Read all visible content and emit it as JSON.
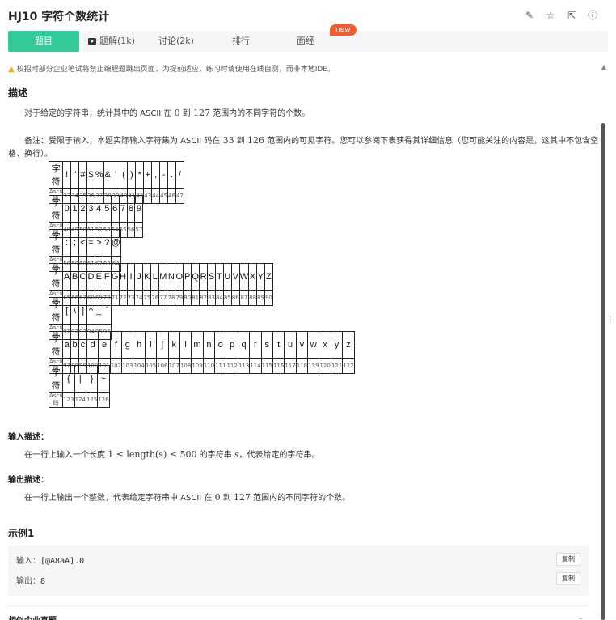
{
  "header": {
    "title": "HJ10  字符个数统计",
    "icons": [
      "edit-icon",
      "star-icon",
      "share-icon",
      "info-icon"
    ]
  },
  "tabs": [
    {
      "label": "题目",
      "active": true
    },
    {
      "label": "题解(1k)",
      "icon": "video-icon"
    },
    {
      "label": "讨论(2k)"
    },
    {
      "label": "排行"
    },
    {
      "label": "面经"
    }
  ],
  "new_badge": "new",
  "warning": "校招时部分企业笔试将禁止编程题跳出页面，为提前适应，练习时请使用在线自测，而非本地IDE。",
  "description": {
    "title": "描述",
    "p1_a": "对于给定的字符串，统计其中的 ASCII 在 ",
    "p1_n1": "0",
    "p1_b": " 到 ",
    "p1_n2": "127",
    "p1_c": " 范围内的不同字符的个数。",
    "note_a": "备注：受限于输入，本题实际输入字符集为 ASCII 码在 ",
    "note_n1": "33",
    "note_b": " 到 ",
    "note_n2": "126",
    "note_c": " 范围内的可见字符。您可以参阅下表获得其详细信息（您可能关注的内容是，这其中不包含空格、换行）。"
  },
  "ascii_table": {
    "char_label": "字符",
    "code_label": "Ascii码",
    "rows": [
      {
        "chars": [
          "!",
          "\"",
          "#",
          "$",
          "%",
          "&",
          "'",
          "(",
          ")",
          "*",
          "+",
          ",",
          "-",
          ".",
          "/"
        ],
        "codes": [
          "33",
          "34",
          "35",
          "36",
          "37",
          "38",
          "39",
          "40",
          "41",
          "42",
          "43",
          "44",
          "45",
          "46",
          "47"
        ]
      },
      {
        "chars": [
          "0",
          "1",
          "2",
          "3",
          "4",
          "5",
          "6",
          "7",
          "8",
          "9"
        ],
        "codes": [
          "48",
          "49",
          "50",
          "51",
          "52",
          "53",
          "54",
          "55",
          "56",
          "57"
        ]
      },
      {
        "chars": [
          ":",
          ";",
          "<",
          "=",
          ">",
          "?",
          "@"
        ],
        "codes": [
          "58",
          "59",
          "60",
          "61",
          "62",
          "63",
          "64"
        ]
      },
      {
        "chars": [
          "A",
          "B",
          "C",
          "D",
          "E",
          "F",
          "G",
          "H",
          "I",
          "J",
          "K",
          "L",
          "M",
          "N",
          "O",
          "P",
          "Q",
          "R",
          "S",
          "T",
          "U",
          "V",
          "W",
          "X",
          "Y",
          "Z"
        ],
        "codes": [
          "65",
          "66",
          "67",
          "68",
          "69",
          "70",
          "71",
          "72",
          "73",
          "74",
          "75",
          "76",
          "77",
          "78",
          "79",
          "80",
          "81",
          "82",
          "83",
          "84",
          "85",
          "86",
          "87",
          "88",
          "89",
          "90"
        ]
      },
      {
        "chars": [
          "[",
          "\\",
          "]",
          "^",
          "_",
          "`"
        ],
        "codes": [
          "91",
          "92",
          "93",
          "94",
          "95",
          "96"
        ]
      },
      {
        "chars": [
          "a",
          "b",
          "c",
          "d",
          "e",
          "f",
          "g",
          "h",
          "i",
          "j",
          "k",
          "l",
          "m",
          "n",
          "o",
          "p",
          "q",
          "r",
          "s",
          "t",
          "u",
          "v",
          "w",
          "x",
          "y",
          "z"
        ],
        "codes": [
          "97",
          "98",
          "99",
          "100",
          "101",
          "102",
          "103",
          "104",
          "105",
          "106",
          "107",
          "108",
          "109",
          "110",
          "111",
          "112",
          "113",
          "114",
          "115",
          "116",
          "117",
          "118",
          "119",
          "120",
          "121",
          "122"
        ]
      },
      {
        "chars": [
          "{",
          "|",
          "}",
          "~"
        ],
        "codes": [
          "123",
          "124",
          "125",
          "126"
        ]
      }
    ]
  },
  "input_desc": {
    "title": "输入描述：",
    "text_a": "在一行上输入一个长度 ",
    "math": "1 ≤ length(s) ≤ 500",
    "text_b": " 的字符串 ",
    "var": "s",
    "text_c": "，代表给定的字符串。"
  },
  "output_desc": {
    "title": "输出描述：",
    "text_a": "在一行上输出一个整数，代表给定字符串中 ASCII 在 ",
    "n1": "0",
    "text_b": " 到 ",
    "n2": "127",
    "text_c": " 范围内的不同字符的个数。"
  },
  "example": {
    "title": "示例1",
    "input_label": "输入：",
    "input_value": "[@A8aA].0",
    "output_label": "输出：",
    "output_value": "8",
    "copy_label": "复制"
  },
  "related": {
    "title": "相似企业真题"
  }
}
